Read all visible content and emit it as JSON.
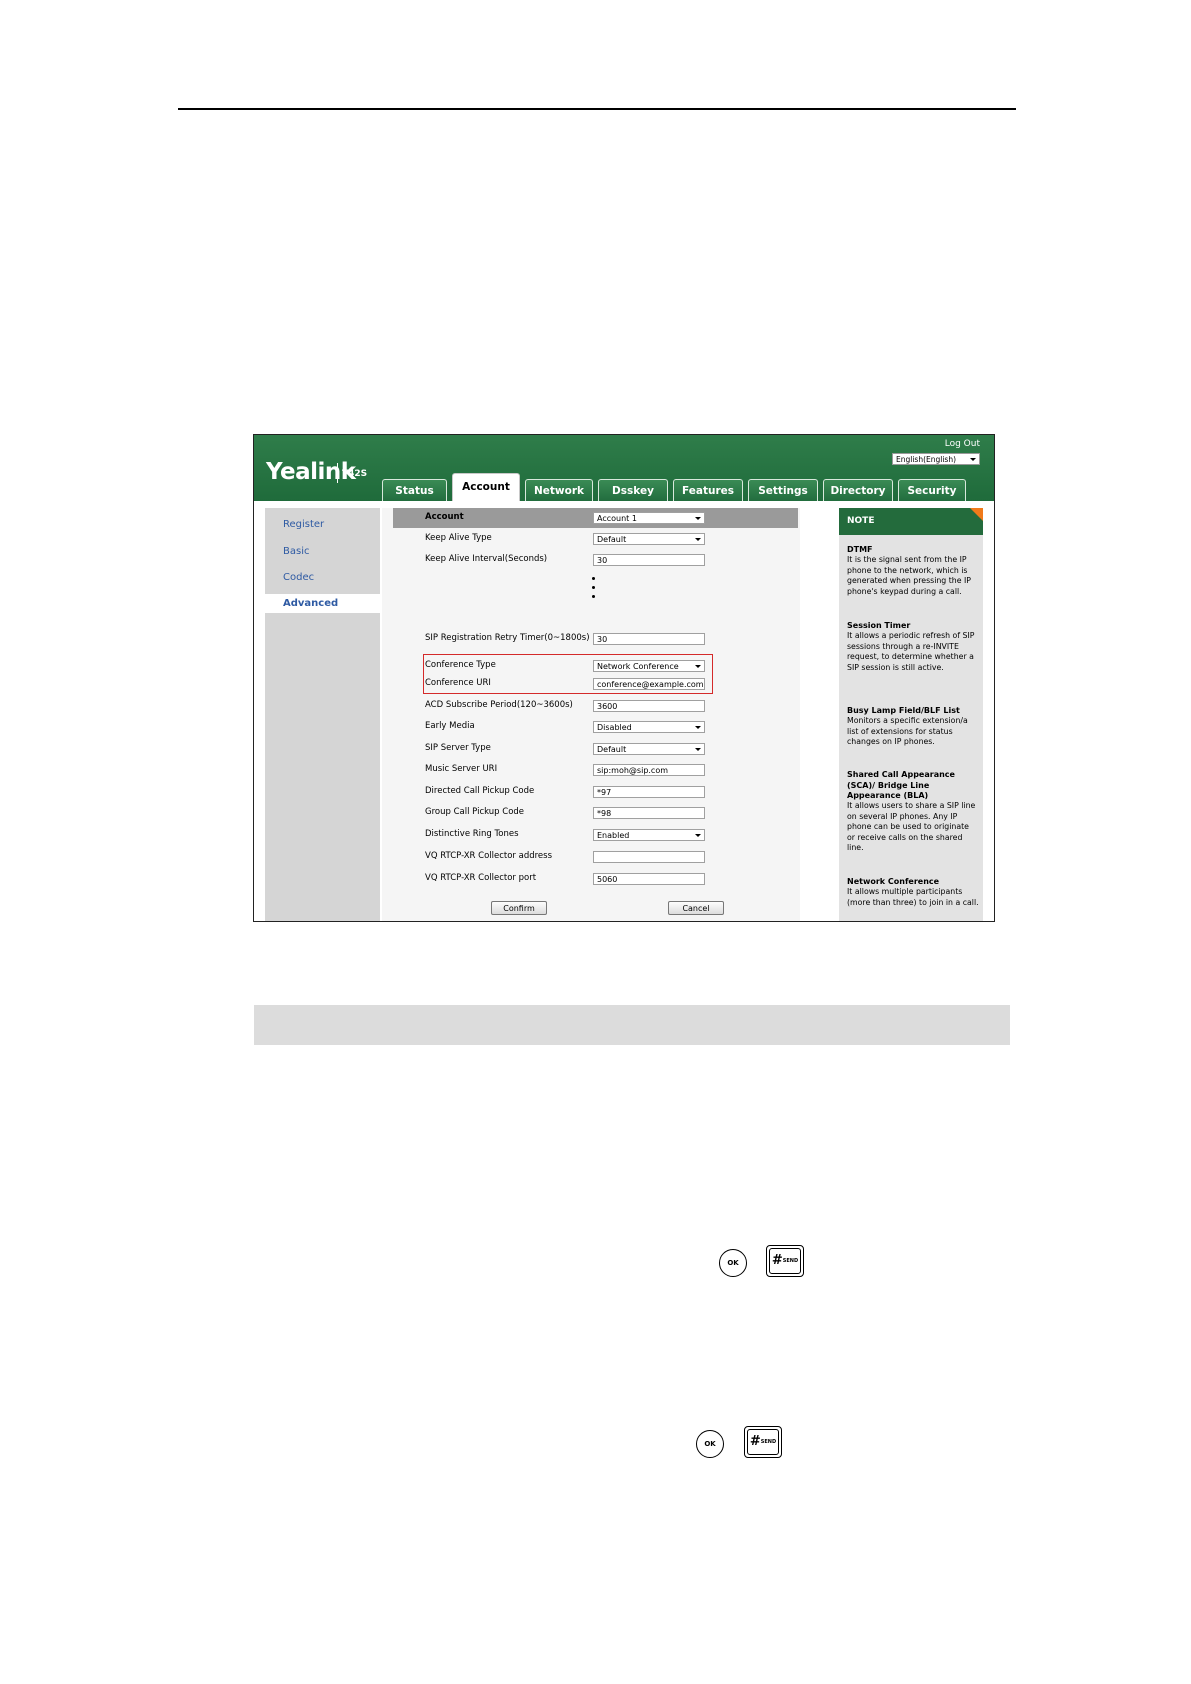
{
  "header": {
    "logo": "Yealink",
    "model": "T42S",
    "logout": "Log Out",
    "language": "English(English)"
  },
  "tabs": [
    "Status",
    "Account",
    "Network",
    "Dsskey",
    "Features",
    "Settings",
    "Directory",
    "Security"
  ],
  "sidebar": [
    "Register",
    "Basic",
    "Codec",
    "Advanced"
  ],
  "form": {
    "account_label": "Account",
    "account_value": "Account 1",
    "rows": [
      {
        "label": "Keep Alive Type",
        "value": "Default"
      },
      {
        "label": "Keep Alive Interval(Seconds)",
        "value": "30"
      },
      {
        "label": "SIP Registration Retry Timer(0~1800s)",
        "value": "30"
      },
      {
        "label": "Conference Type",
        "value": "Network Conference"
      },
      {
        "label": "Conference URI",
        "value": "conference@example.com"
      },
      {
        "label": "ACD Subscribe Period(120~3600s)",
        "value": "3600"
      },
      {
        "label": "Early Media",
        "value": "Disabled"
      },
      {
        "label": "SIP Server Type",
        "value": "Default"
      },
      {
        "label": "Music Server URI",
        "value": "sip:moh@sip.com"
      },
      {
        "label": "Directed Call Pickup Code",
        "value": "*97"
      },
      {
        "label": "Group Call Pickup Code",
        "value": "*98"
      },
      {
        "label": "Distinctive Ring Tones",
        "value": "Enabled"
      },
      {
        "label": "VQ RTCP-XR Collector address",
        "value": ""
      },
      {
        "label": "VQ RTCP-XR Collector port",
        "value": "5060"
      }
    ],
    "confirm": "Confirm",
    "cancel": "Cancel"
  },
  "note": {
    "heading": "NOTE",
    "sections": [
      {
        "title": "DTMF",
        "body": "It is the signal sent from the IP phone to the network, which is generated when pressing the IP phone's keypad during a call."
      },
      {
        "title": "Session Timer",
        "body": "It allows a periodic refresh of SIP sessions through a re-INVITE request, to determine whether a SIP session is still active."
      },
      {
        "title": "Busy Lamp Field/BLF List",
        "body": "Monitors a specific extension/a list of extensions for status changes on IP phones."
      },
      {
        "title": "Shared Call Appearance (SCA)/ Bridge Line Appearance (BLA)",
        "body": "It allows users to share a SIP line on several IP phones. Any IP phone can be used to originate or receive calls on the shared line."
      },
      {
        "title": "Network Conference",
        "body": "It allows multiple participants (more than three) to join in a call."
      }
    ]
  },
  "keys": {
    "ok": "OK",
    "hash": "#",
    "send": "SEND"
  }
}
